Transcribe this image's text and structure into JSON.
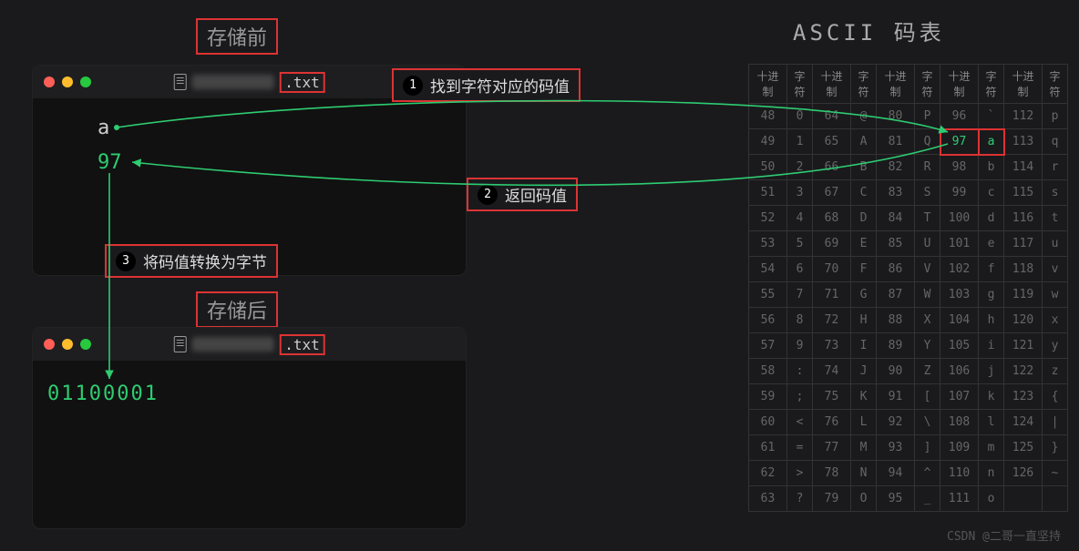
{
  "titles": {
    "before": "存储前",
    "after": "存储后",
    "ascii": "ASCII 码表"
  },
  "file": {
    "ext": ".txt"
  },
  "values": {
    "char": "a",
    "code": "97",
    "binary": "01100001"
  },
  "callouts": {
    "c1_num": "1",
    "c1_text": "找到字符对应的码值",
    "c2_num": "2",
    "c2_text": "返回码值",
    "c3_num": "3",
    "c3_text": "将码值转换为字节"
  },
  "ascii": {
    "headers": [
      "十进制",
      "字符",
      "十进制",
      "字符",
      "十进制",
      "字符",
      "十进制",
      "字符",
      "十进制",
      "字符"
    ],
    "rows": [
      [
        "48",
        "0",
        "64",
        "@",
        "80",
        "P",
        "96",
        "`",
        "112",
        "p"
      ],
      [
        "49",
        "1",
        "65",
        "A",
        "81",
        "Q",
        "97",
        "a",
        "113",
        "q"
      ],
      [
        "50",
        "2",
        "66",
        "B",
        "82",
        "R",
        "98",
        "b",
        "114",
        "r"
      ],
      [
        "51",
        "3",
        "67",
        "C",
        "83",
        "S",
        "99",
        "c",
        "115",
        "s"
      ],
      [
        "52",
        "4",
        "68",
        "D",
        "84",
        "T",
        "100",
        "d",
        "116",
        "t"
      ],
      [
        "53",
        "5",
        "69",
        "E",
        "85",
        "U",
        "101",
        "e",
        "117",
        "u"
      ],
      [
        "54",
        "6",
        "70",
        "F",
        "86",
        "V",
        "102",
        "f",
        "118",
        "v"
      ],
      [
        "55",
        "7",
        "71",
        "G",
        "87",
        "W",
        "103",
        "g",
        "119",
        "w"
      ],
      [
        "56",
        "8",
        "72",
        "H",
        "88",
        "X",
        "104",
        "h",
        "120",
        "x"
      ],
      [
        "57",
        "9",
        "73",
        "I",
        "89",
        "Y",
        "105",
        "i",
        "121",
        "y"
      ],
      [
        "58",
        ":",
        "74",
        "J",
        "90",
        "Z",
        "106",
        "j",
        "122",
        "z"
      ],
      [
        "59",
        ";",
        "75",
        "K",
        "91",
        "[",
        "107",
        "k",
        "123",
        "{"
      ],
      [
        "60",
        "<",
        "76",
        "L",
        "92",
        "\\",
        "108",
        "l",
        "124",
        "|"
      ],
      [
        "61",
        "=",
        "77",
        "M",
        "93",
        "]",
        "109",
        "m",
        "125",
        "}"
      ],
      [
        "62",
        ">",
        "78",
        "N",
        "94",
        "^",
        "110",
        "n",
        "126",
        "~"
      ],
      [
        "63",
        "?",
        "79",
        "O",
        "95",
        "_",
        "111",
        "o",
        " ",
        " "
      ]
    ],
    "highlight": {
      "row": 1,
      "colStart": 6,
      "colEnd": 7
    }
  },
  "watermark": "CSDN @二哥一直坚持",
  "colors": {
    "accent": "#2ecc71",
    "annot": "#d33"
  }
}
